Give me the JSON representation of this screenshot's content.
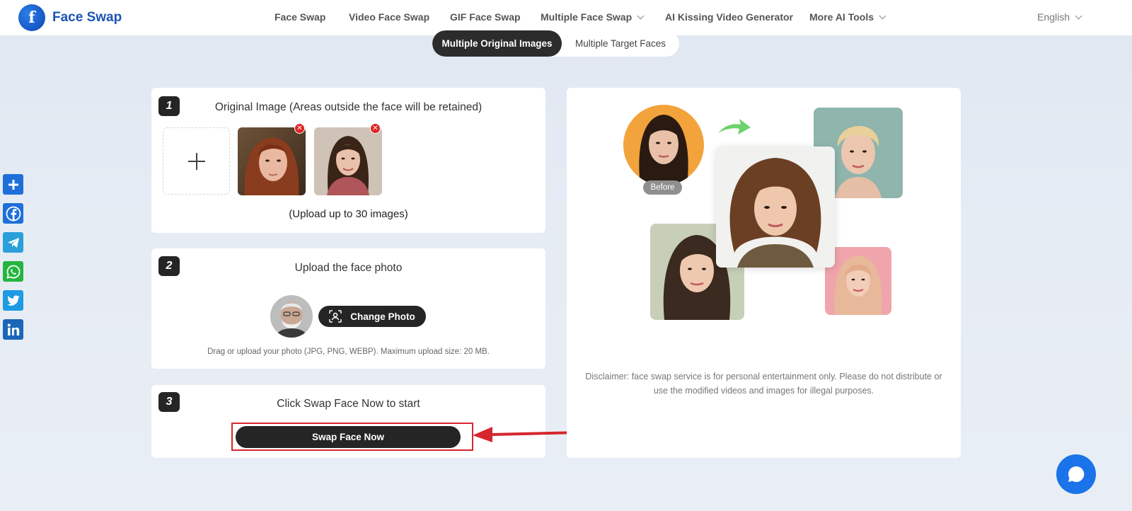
{
  "header": {
    "brand": "Face Swap",
    "logo_letter": "f",
    "nav": [
      {
        "label": "Face Swap",
        "dropdown": false
      },
      {
        "label": "Video Face Swap",
        "dropdown": false
      },
      {
        "label": "GIF Face Swap",
        "dropdown": false
      },
      {
        "label": "Multiple Face Swap",
        "dropdown": true
      },
      {
        "label": "AI Kissing Video Generator",
        "dropdown": false
      },
      {
        "label": "More AI Tools",
        "dropdown": true
      }
    ],
    "language": "English"
  },
  "mode_toggle": {
    "active": "Multiple Original Images",
    "inactive": "Multiple Target Faces"
  },
  "step1": {
    "number": "1",
    "title": "Original Image (Areas outside the face will be retained)",
    "upload_hint": "(Upload up to 30 images)",
    "remove_symbol": "✕"
  },
  "step2": {
    "number": "2",
    "title": "Upload the face photo",
    "change_button": "Change Photo",
    "note": "Drag or upload your photo (JPG, PNG, WEBP). Maximum upload size: 20 MB."
  },
  "step3": {
    "number": "3",
    "title": "Click Swap Face Now to start",
    "swap_button": "Swap Face Now"
  },
  "preview": {
    "before_label": "Before",
    "disclaimer": "Disclaimer: face swap service is for personal entertainment only. Please do not distribute or use the modified videos and images for illegal purposes."
  },
  "share_icons": [
    "share-plus-icon",
    "facebook-icon",
    "telegram-icon",
    "whatsapp-icon",
    "twitter-icon",
    "linkedin-icon"
  ],
  "colors": {
    "brand": "#1a55b5",
    "dark_button": "#252525",
    "highlight": "#d6262d",
    "chat": "#1a73e8"
  }
}
